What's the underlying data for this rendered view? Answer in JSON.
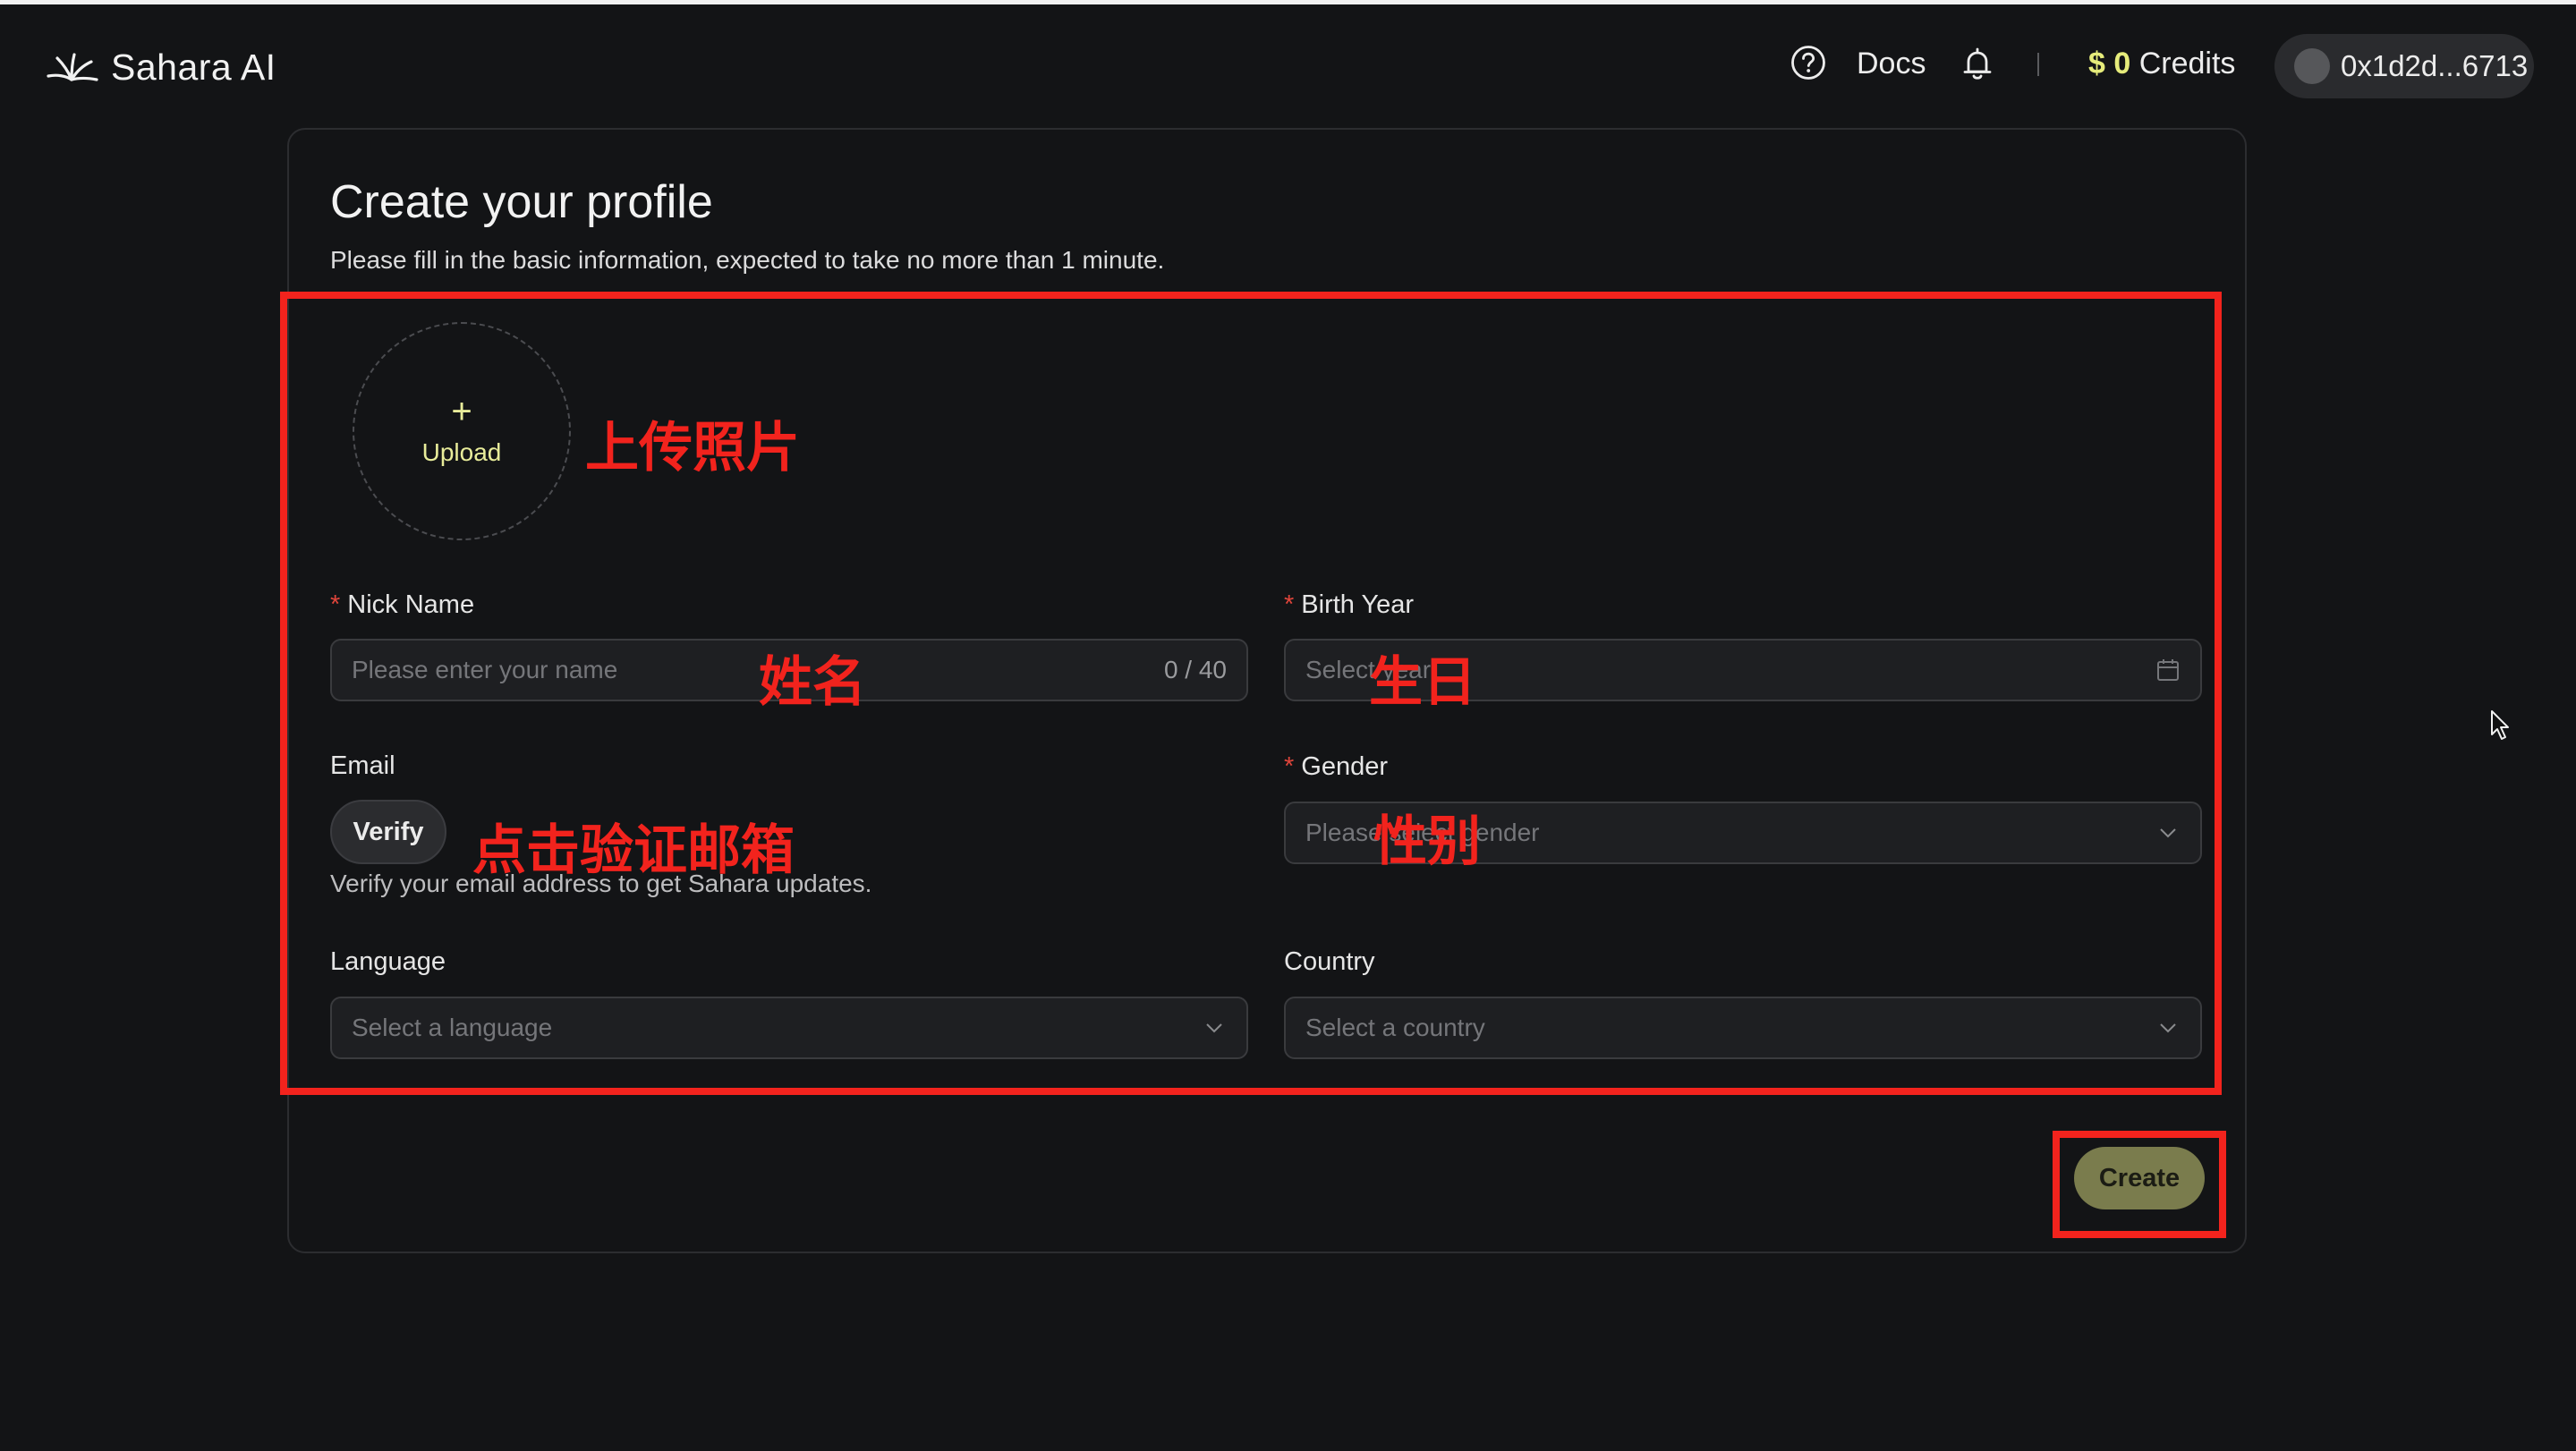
{
  "header": {
    "brand": "Sahara AI",
    "docs_label": "Docs",
    "credits_amount": "$ 0",
    "credits_label": " Credits",
    "wallet_address": "0x1d2d...6713"
  },
  "profile_form": {
    "title": "Create your profile",
    "subtitle": "Please fill in the basic information, expected to take no more than 1 minute.",
    "upload": {
      "plus": "+",
      "label": "Upload"
    },
    "nick_name": {
      "label": "Nick Name",
      "required": "*",
      "placeholder": "Please enter your name",
      "counter": "0 / 40"
    },
    "birth_year": {
      "label": "Birth Year",
      "required": "*",
      "placeholder": "Select year"
    },
    "email": {
      "label": "Email",
      "verify_label": "Verify",
      "hint": "Verify your email address to get Sahara updates."
    },
    "gender": {
      "label": "Gender",
      "required": "*",
      "placeholder": "Please select gender"
    },
    "language": {
      "label": "Language",
      "placeholder": "Select a language"
    },
    "country": {
      "label": "Country",
      "placeholder": "Select a country"
    },
    "create_label": "Create"
  },
  "annotations": {
    "upload_photo": "上传照片",
    "name": "姓名",
    "birthday": "生日",
    "verify_email": "点击验证邮箱",
    "gender": "性别"
  },
  "colors": {
    "background": "#131416",
    "accent": "#e6ec7b",
    "annotation": "#f2231d",
    "create_button": "#7a7c4d"
  }
}
